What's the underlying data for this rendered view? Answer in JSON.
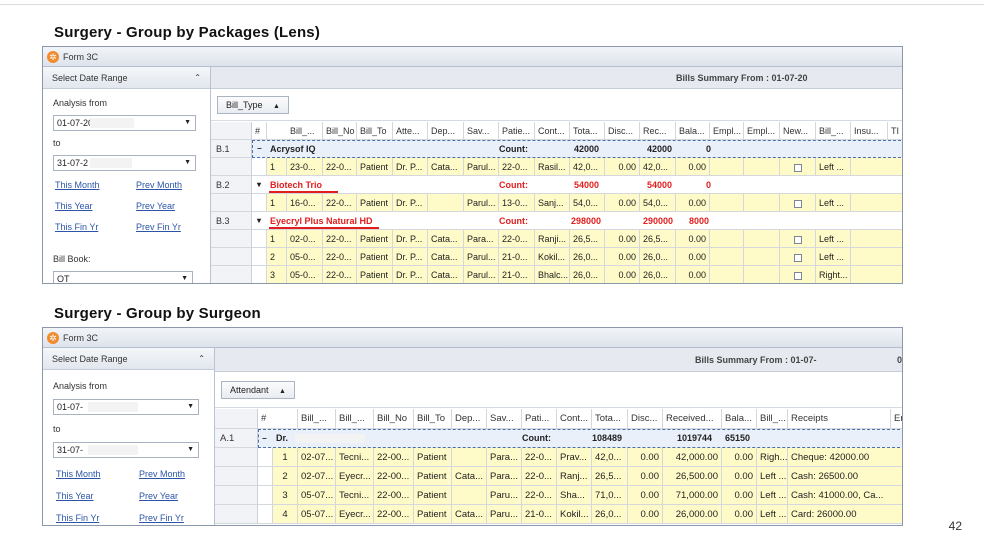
{
  "slide_number": "42",
  "panel1": {
    "heading": "Surgery - Group by Packages (Lens)",
    "window_title": "Form 3C",
    "sidebar": {
      "date_range_header": "Select Date Range",
      "analysis_from_label": "Analysis from",
      "from_date": "01-07-20",
      "to_label": "to",
      "to_date": "31-07-2",
      "links": [
        "This Month",
        "Prev Month",
        "This Year",
        "Prev Year",
        "This Fin Yr",
        "Prev Fin Yr"
      ],
      "bill_book_label": "Bill Book:",
      "bill_book_value": "OT"
    },
    "summary": "Bills Summary  From : 01-07-20",
    "group_by": "Bill_Type",
    "columns": [
      "#",
      "Bill_...",
      "Bill_No",
      "Bill_To",
      "Atte...",
      "Dep...",
      "Sav...",
      "Patie...",
      "Cont...",
      "Tota...",
      "Disc...",
      "Rec...",
      "Bala...",
      "Empl...",
      "Empl...",
      "New...",
      "Bill_...",
      "Insu...",
      "TI"
    ],
    "groups": [
      {
        "code": "B.1",
        "name": "Acrysof IQ",
        "count_label": "Count:",
        "total": "42000",
        "received": "42000",
        "balance": "0",
        "rows": [
          [
            "1",
            "23-0...",
            "22-0...",
            "Patient",
            "Dr. P...",
            "Cata...",
            "Parul...",
            "22-0...",
            "Rasil...",
            "42,0...",
            "0.00",
            "42,0...",
            "0.00",
            "",
            "",
            "",
            "Left ..."
          ]
        ]
      },
      {
        "code": "B.2",
        "name": "Biotech Trio",
        "count_label": "Count:",
        "total": "54000",
        "received": "54000",
        "balance": "0",
        "rows": [
          [
            "1",
            "16-0...",
            "22-0...",
            "Patient",
            "Dr. P...",
            "",
            "Parul...",
            "13-0...",
            "Sanj...",
            "54,0...",
            "0.00",
            "54,0...",
            "0.00",
            "",
            "",
            "",
            "Left ..."
          ]
        ]
      },
      {
        "code": "B.3",
        "name": "Eyecryl Plus Natural HD",
        "count_label": "Count:",
        "total": "298000",
        "received": "290000",
        "balance": "8000",
        "rows": [
          [
            "1",
            "02-0...",
            "22-0...",
            "Patient",
            "Dr. P...",
            "Cata...",
            "Para...",
            "22-0...",
            "Ranji...",
            "26,5...",
            "0.00",
            "26,5...",
            "0.00",
            "",
            "",
            "",
            "Left ..."
          ],
          [
            "2",
            "05-0...",
            "22-0...",
            "Patient",
            "Dr. P...",
            "Cata...",
            "Parul...",
            "21-0...",
            "Kokil...",
            "26,0...",
            "0.00",
            "26,0...",
            "0.00",
            "",
            "",
            "",
            "Left ..."
          ],
          [
            "3",
            "05-0...",
            "22-0...",
            "Patient",
            "Dr. P...",
            "Cata...",
            "Parul...",
            "21-0...",
            "Bhalc...",
            "26,0...",
            "0.00",
            "26,0...",
            "0.00",
            "",
            "",
            "",
            "Right..."
          ]
        ]
      }
    ]
  },
  "panel2": {
    "heading": "Surgery - Group by Surgeon",
    "window_title": "Form 3C",
    "sidebar": {
      "date_range_header": "Select Date Range",
      "analysis_from_label": "Analysis from",
      "from_date": "01-07-",
      "to_label": "to",
      "to_date": "31-07-",
      "links": [
        "This Month",
        "Prev Month",
        "This Year",
        "Prev Year",
        "This Fin Yr",
        "Prev Fin Yr"
      ]
    },
    "summary": "Bills Summary  From : 01-07-",
    "group_by": "Attendant",
    "columns": [
      "#",
      "Bill_...",
      "Bill_...",
      "Bill_No",
      "Bill_To",
      "Dep...",
      "Sav...",
      "Pati...",
      "Cont...",
      "Tota...",
      "Disc...",
      "Received...",
      "Bala...",
      "Bill_...",
      "Receipts",
      "Er"
    ],
    "groups": [
      {
        "code": "A.1",
        "name": "Dr.",
        "count_label": "Count:",
        "total": "108489",
        "received": "1019744",
        "balance": "65150",
        "rows": [
          [
            "1",
            "02-07...",
            "Tecni...",
            "22-00...",
            "Patient",
            "",
            "Para...",
            "22-0...",
            "Prav...",
            "42,0...",
            "0.00",
            "42,000.00",
            "0.00",
            "Righ...",
            "Cheque: 42000.00"
          ],
          [
            "2",
            "02-07...",
            "Eyecr...",
            "22-00...",
            "Patient",
            "Cata...",
            "Para...",
            "22-0...",
            "Ranj...",
            "26,5...",
            "0.00",
            "26,500.00",
            "0.00",
            "Left ...",
            "Cash: 26500.00"
          ],
          [
            "3",
            "05-07...",
            "Tecni...",
            "22-00...",
            "Patient",
            "",
            "Paru...",
            "22-0...",
            "Sha...",
            "71,0...",
            "0.00",
            "71,000.00",
            "0.00",
            "Left ...",
            "Cash: 41000.00, Ca..."
          ],
          [
            "4",
            "05-07...",
            "Eyecr...",
            "22-00...",
            "Patient",
            "Cata...",
            "Paru...",
            "21-0...",
            "Kokil...",
            "26,0...",
            "0.00",
            "26,000.00",
            "0.00",
            "Left ...",
            "Card: 26000.00"
          ]
        ]
      }
    ]
  }
}
